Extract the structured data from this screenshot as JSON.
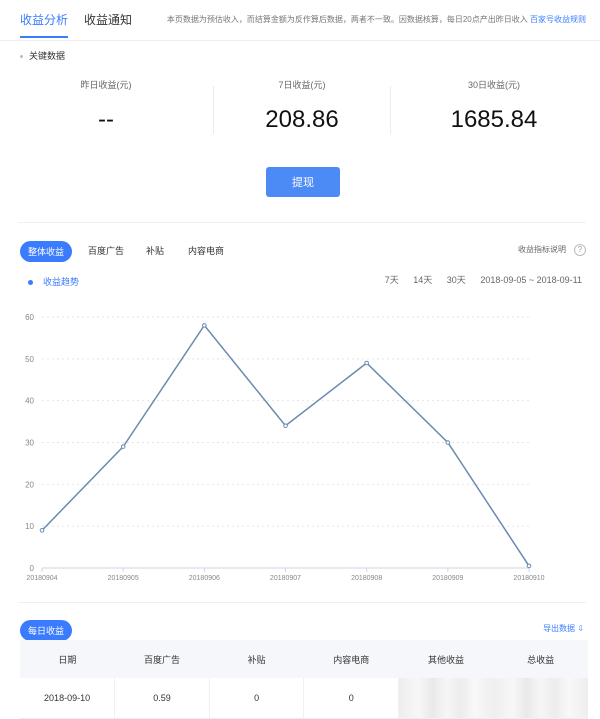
{
  "top_tabs": [
    {
      "label": "收益分析",
      "active": true
    },
    {
      "label": "收益通知",
      "active": false
    }
  ],
  "notice": {
    "text": "本页数据为预估收入，而结算金额为反作算后数据，两者不一致。因数据核算，每日20点产出昨日收入",
    "link": "百家号收益规则"
  },
  "key_section_title": "关键数据",
  "kpis": [
    {
      "label": "昨日收益(元)",
      "value": "--"
    },
    {
      "label": "7日收益(元)",
      "value": "208.86"
    },
    {
      "label": "30日收益(元)",
      "value": "1685.84"
    }
  ],
  "withdraw_label": "提现",
  "chart_tabs": [
    {
      "label": "整体收益",
      "active": true
    },
    {
      "label": "百度广告",
      "active": false
    },
    {
      "label": "补贴",
      "active": false
    },
    {
      "label": "内容电商",
      "active": false
    }
  ],
  "metric_help_label": "收益指标说明",
  "help_icon_glyph": "?",
  "trend_legend_label": "收益趋势",
  "ranges": [
    "7天",
    "14天",
    "30天"
  ],
  "date_range": "2018-09-05 ~ 2018-09-11",
  "colors": {
    "accent": "#3b7cff",
    "line": "#6a8ab0",
    "grid": "#e5e5e5"
  },
  "chart_data": {
    "type": "line",
    "x": [
      "20180904",
      "20180905",
      "20180906",
      "20180907",
      "20180908",
      "20180909",
      "20180910"
    ],
    "series": [
      {
        "name": "收益趋势",
        "values": [
          9,
          29,
          58,
          34,
          49,
          30,
          0.5
        ]
      }
    ],
    "yticks": [
      0,
      10,
      20,
      30,
      40,
      50,
      60
    ],
    "ylim": [
      0,
      60
    ],
    "grid": true
  },
  "daily_pill_label": "每日收益",
  "export_label": "导出数据 ⇩",
  "table": {
    "headers": [
      "日期",
      "百度广告",
      "补贴",
      "内容电商",
      "其他收益",
      "总收益"
    ],
    "rows": [
      [
        "2018-09-10",
        "0.59",
        "0",
        "0",
        "",
        ""
      ]
    ]
  }
}
